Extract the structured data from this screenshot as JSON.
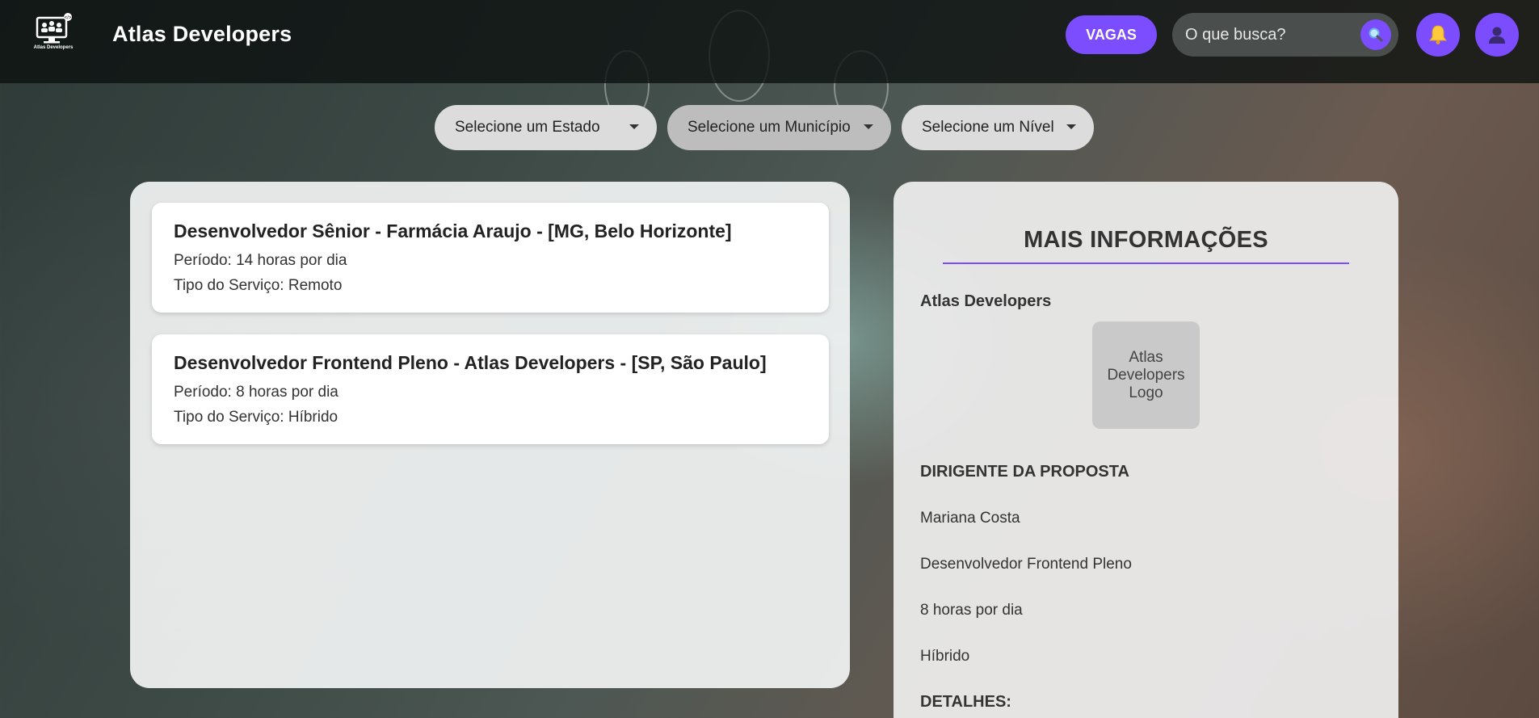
{
  "header": {
    "logo_text": "Atlas Developers",
    "brand": "Atlas Developers",
    "nav_button": "VAGAS",
    "search_placeholder": "O que busca?",
    "search_icon": "search-icon",
    "notification_icon": "bell-icon",
    "profile_icon": "user-icon"
  },
  "filters": [
    {
      "label": "Selecione um Estado"
    },
    {
      "label": "Selecione um Município"
    },
    {
      "label": "Selecione um Nível"
    }
  ],
  "jobs": [
    {
      "title": "Desenvolvedor Sênior - Farmácia Araujo - [MG, Belo Horizonte]",
      "period": "Período: 14 horas por dia",
      "service": "Tipo do Serviço: Remoto"
    },
    {
      "title": "Desenvolvedor Frontend Pleno - Atlas Developers - [SP, São Paulo]",
      "period": "Período: 8 horas por dia",
      "service": "Tipo do Serviço: Híbrido"
    }
  ],
  "info": {
    "title": "MAIS INFORMAÇÕES",
    "company": "Atlas Developers",
    "logo_placeholder": "Atlas Developers Logo",
    "manager_label": "DIRIGENTE DA PROPOSTA",
    "manager": "Mariana Costa",
    "position": "Desenvolvedor Frontend Pleno",
    "hours": "8 horas por dia",
    "mode": "Híbrido",
    "details_label": "DETALHES:"
  },
  "colors": {
    "accent": "#7b4dff",
    "header_bg": "#0a100e"
  }
}
